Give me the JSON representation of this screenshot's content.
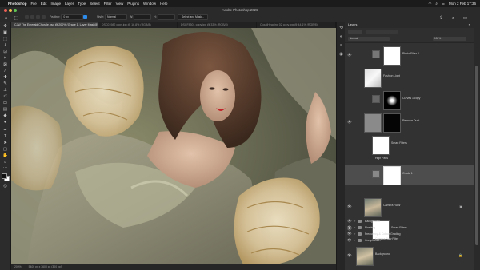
{
  "menubar": {
    "app": "Photoshop",
    "items": [
      "File",
      "Edit",
      "Image",
      "Layer",
      "Type",
      "Select",
      "Filter",
      "View",
      "Plugins",
      "Window",
      "Help"
    ],
    "clock": "Mon 2 Feb 17:36"
  },
  "window": {
    "title": "Adobe Photoshop 2026"
  },
  "options": {
    "feather_label": "Feather:",
    "feather_value": "0 px",
    "style_label": "Style:",
    "style_value": "Normal",
    "width_label": "W:",
    "height_label": "H:",
    "select_mask": "Select and Mask..."
  },
  "tabs": [
    {
      "label": "CJW The Emerald Chorale.psd @ 200% (Grade 1, Layer Mask/8) *",
      "active": true
    },
    {
      "label": "DSC01982 copy.jpg @ 16.8% (RGB/8)",
      "active": false
    },
    {
      "label": "DSCF8501 copy.jpg @ 33% (RGB/8)",
      "active": false
    },
    {
      "label": "CloudHeading 02 copy.jpg @ 44.1% (RGB/8)",
      "active": false
    }
  ],
  "status": {
    "zoom": "200%",
    "doc": "5400 px x 3600 px (300 ppi)"
  },
  "panel": {
    "title": "Layers",
    "mode": "Normal",
    "opacity": "100%"
  },
  "layers": [
    {
      "name": "Photo Filter 2"
    },
    {
      "name": "Fashion Light"
    },
    {
      "name": "Curves 1 copy"
    },
    {
      "name": "Remove Dust"
    },
    {
      "name": "Smart Filters"
    },
    {
      "name": "High Pass"
    },
    {
      "name": "Grade 1"
    },
    {
      "name": "Camera RAW"
    },
    {
      "name": "Smart Filters"
    },
    {
      "name": "Camera Raw Filter"
    },
    {
      "name": "Background"
    },
    {
      "name": "Flashing"
    },
    {
      "name": "Frequency & Colour Grading"
    },
    {
      "name": "Composition"
    },
    {
      "name": "Background"
    }
  ],
  "colors": {
    "ui_dark": "#1e1e1e",
    "panel": "#323232",
    "selection": "#4d4d4d",
    "accent": "#2d8ceb"
  }
}
